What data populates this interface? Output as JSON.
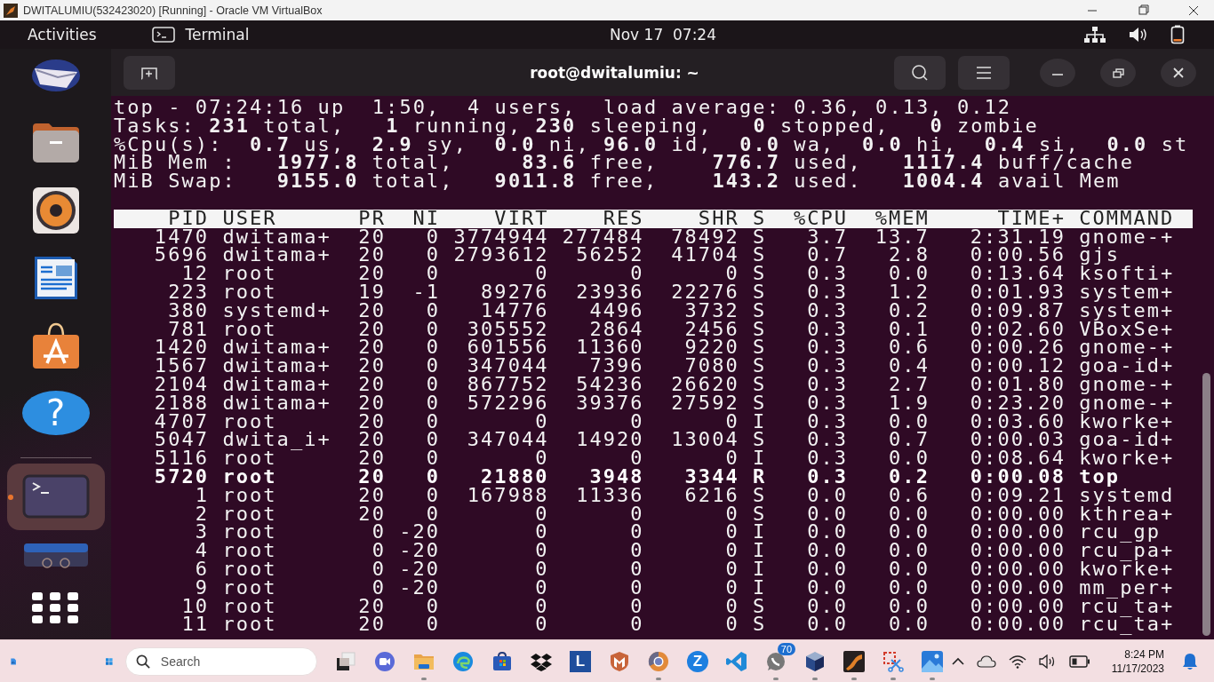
{
  "host_window": {
    "title": "DWITALUMIU(532423020) [Running] - Oracle VM VirtualBox"
  },
  "top_bar": {
    "activities": "Activities",
    "app": "Terminal",
    "clock": "Nov 17  07:24"
  },
  "dock": {
    "items": [
      {
        "kind": "mail",
        "selected": false
      },
      {
        "kind": "files",
        "selected": false
      },
      {
        "kind": "music",
        "selected": false
      },
      {
        "kind": "writer",
        "selected": false
      },
      {
        "kind": "software",
        "selected": false
      },
      {
        "kind": "help",
        "label": "?",
        "selected": false
      },
      {
        "kind": "terminal",
        "selected": true
      },
      {
        "kind": "drive",
        "selected": false
      }
    ]
  },
  "terminal": {
    "title": "root@dwitalumiu: ~",
    "summary": [
      "top - 07:24:16 up  1:50,  4 users,  load average: 0.36, 0.13, 0.12",
      "Tasks: **231** total,   **1** running, **230** sleeping,   **0** stopped,   **0** zombie",
      "%Cpu(s):  **0.7** us,  **2.9** sy,  **0.0** ni, **96.0** id,  **0.0** wa,  **0.0** hi,  **0.4** si,  **0.0** st",
      "MiB Mem :   **1977.8** total,     **83.6** free,    **776.7** used,   **1117.4** buff/cache",
      "MiB Swap:   **9155.0** total,   **9011.8** free,    **143.2** used.   **1004.4** avail Mem"
    ],
    "columns": [
      "PID",
      "USER",
      "PR",
      "NI",
      "VIRT",
      "RES",
      "SHR",
      "S",
      "%CPU",
      "%MEM",
      "TIME+",
      "COMMAND"
    ],
    "rows": [
      {
        "bold": false,
        "cells": [
          "1470",
          "dwitama+",
          "20",
          "0",
          "3774944",
          "277484",
          "78492",
          "S",
          "3.7",
          "13.7",
          "2:31.19",
          "gnome-+"
        ]
      },
      {
        "bold": false,
        "cells": [
          "5696",
          "dwitama+",
          "20",
          "0",
          "2793612",
          "56252",
          "41704",
          "S",
          "0.7",
          "2.8",
          "0:00.56",
          "gjs"
        ]
      },
      {
        "bold": false,
        "cells": [
          "12",
          "root",
          "20",
          "0",
          "0",
          "0",
          "0",
          "S",
          "0.3",
          "0.0",
          "0:13.64",
          "ksofti+"
        ]
      },
      {
        "bold": false,
        "cells": [
          "223",
          "root",
          "19",
          "-1",
          "89276",
          "23936",
          "22276",
          "S",
          "0.3",
          "1.2",
          "0:01.93",
          "system+"
        ]
      },
      {
        "bold": false,
        "cells": [
          "380",
          "systemd+",
          "20",
          "0",
          "14776",
          "4496",
          "3732",
          "S",
          "0.3",
          "0.2",
          "0:09.87",
          "system+"
        ]
      },
      {
        "bold": false,
        "cells": [
          "781",
          "root",
          "20",
          "0",
          "305552",
          "2864",
          "2456",
          "S",
          "0.3",
          "0.1",
          "0:02.60",
          "VBoxSe+"
        ]
      },
      {
        "bold": false,
        "cells": [
          "1420",
          "dwitama+",
          "20",
          "0",
          "601556",
          "11360",
          "9220",
          "S",
          "0.3",
          "0.6",
          "0:00.26",
          "gnome-+"
        ]
      },
      {
        "bold": false,
        "cells": [
          "1567",
          "dwitama+",
          "20",
          "0",
          "347044",
          "7396",
          "7080",
          "S",
          "0.3",
          "0.4",
          "0:00.12",
          "goa-id+"
        ]
      },
      {
        "bold": false,
        "cells": [
          "2104",
          "dwitama+",
          "20",
          "0",
          "867752",
          "54236",
          "26620",
          "S",
          "0.3",
          "2.7",
          "0:01.80",
          "gnome-+"
        ]
      },
      {
        "bold": false,
        "cells": [
          "2188",
          "dwitama+",
          "20",
          "0",
          "572296",
          "39376",
          "27592",
          "S",
          "0.3",
          "1.9",
          "0:23.20",
          "gnome-+"
        ]
      },
      {
        "bold": false,
        "cells": [
          "4707",
          "root",
          "20",
          "0",
          "0",
          "0",
          "0",
          "I",
          "0.3",
          "0.0",
          "0:03.60",
          "kworke+"
        ]
      },
      {
        "bold": false,
        "cells": [
          "5047",
          "dwita_i+",
          "20",
          "0",
          "347044",
          "14920",
          "13004",
          "S",
          "0.3",
          "0.7",
          "0:00.03",
          "goa-id+"
        ]
      },
      {
        "bold": false,
        "cells": [
          "5116",
          "root",
          "20",
          "0",
          "0",
          "0",
          "0",
          "I",
          "0.3",
          "0.0",
          "0:08.64",
          "kworke+"
        ]
      },
      {
        "bold": true,
        "cells": [
          "5720",
          "root",
          "20",
          "0",
          "21880",
          "3948",
          "3344",
          "R",
          "0.3",
          "0.2",
          "0:00.08",
          "top"
        ]
      },
      {
        "bold": false,
        "cells": [
          "1",
          "root",
          "20",
          "0",
          "167988",
          "11336",
          "6216",
          "S",
          "0.0",
          "0.6",
          "0:09.21",
          "systemd"
        ]
      },
      {
        "bold": false,
        "cells": [
          "2",
          "root",
          "20",
          "0",
          "0",
          "0",
          "0",
          "S",
          "0.0",
          "0.0",
          "0:00.00",
          "kthrea+"
        ]
      },
      {
        "bold": false,
        "cells": [
          "3",
          "root",
          "0",
          "-20",
          "0",
          "0",
          "0",
          "I",
          "0.0",
          "0.0",
          "0:00.00",
          "rcu_gp"
        ]
      },
      {
        "bold": false,
        "cells": [
          "4",
          "root",
          "0",
          "-20",
          "0",
          "0",
          "0",
          "I",
          "0.0",
          "0.0",
          "0:00.00",
          "rcu_pa+"
        ]
      },
      {
        "bold": false,
        "cells": [
          "6",
          "root",
          "0",
          "-20",
          "0",
          "0",
          "0",
          "I",
          "0.0",
          "0.0",
          "0:00.00",
          "kworke+"
        ]
      },
      {
        "bold": false,
        "cells": [
          "9",
          "root",
          "0",
          "-20",
          "0",
          "0",
          "0",
          "I",
          "0.0",
          "0.0",
          "0:00.00",
          "mm_per+"
        ]
      },
      {
        "bold": false,
        "cells": [
          "10",
          "root",
          "20",
          "0",
          "0",
          "0",
          "0",
          "S",
          "0.0",
          "0.0",
          "0:00.00",
          "rcu_ta+"
        ]
      },
      {
        "bold": false,
        "cells": [
          "11",
          "root",
          "20",
          "0",
          "0",
          "0",
          "0",
          "S",
          "0.0",
          "0.0",
          "0:00.00",
          "rcu_ta+"
        ]
      }
    ]
  },
  "taskbar": {
    "search": {
      "placeholder": "Search"
    },
    "apps": [
      {
        "kind": "task-view",
        "running": false
      },
      {
        "kind": "meet",
        "running": false
      },
      {
        "kind": "explorer",
        "running": true
      },
      {
        "kind": "edge",
        "running": false
      },
      {
        "kind": "store",
        "running": false
      },
      {
        "kind": "dropbox",
        "running": false
      },
      {
        "kind": "tile",
        "label": "L",
        "running": false
      },
      {
        "kind": "shield",
        "running": false
      },
      {
        "kind": "chrome",
        "running": true
      },
      {
        "kind": "zoom",
        "label": "Z",
        "running": false
      },
      {
        "kind": "vscode",
        "running": false
      },
      {
        "kind": "chat",
        "badge": "70",
        "running": true
      },
      {
        "kind": "virtualbox",
        "running": true
      },
      {
        "kind": "c4d",
        "running": true
      },
      {
        "kind": "snipping",
        "running": true
      },
      {
        "kind": "photos",
        "running": true
      }
    ],
    "time": "8:24 PM",
    "date": "11/17/2023"
  }
}
